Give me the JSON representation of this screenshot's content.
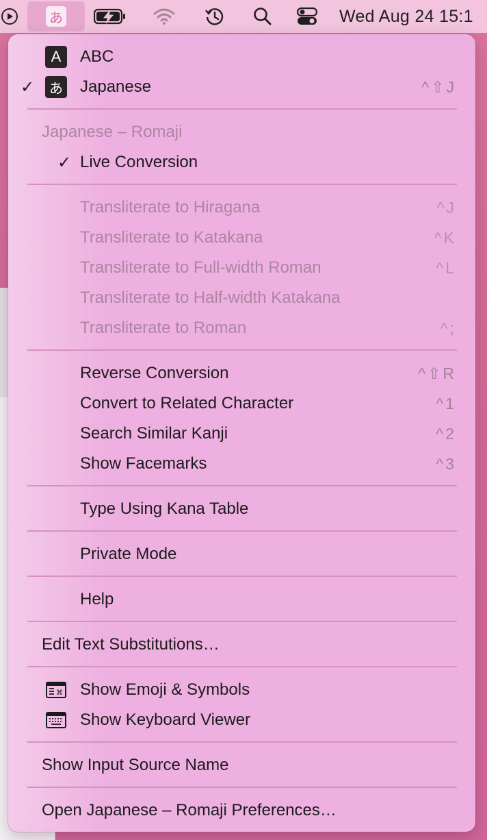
{
  "menubar": {
    "input_icon_glyph": "あ",
    "clock": "Wed Aug 24  15:1",
    "icons": [
      "play-circle-icon",
      "input-source-icon",
      "battery-charging-icon",
      "wifi-icon",
      "time-machine-icon",
      "search-icon",
      "control-center-icon"
    ]
  },
  "menu": {
    "sources": [
      {
        "icon_text": "A",
        "label": "ABC",
        "checked": false,
        "shortcut": ""
      },
      {
        "icon_text": "あ",
        "label": "Japanese",
        "checked": true,
        "shortcut": "^⇧J"
      }
    ],
    "section_header": "Japanese – Romaji",
    "live_conversion": {
      "label": "Live Conversion",
      "checked": true
    },
    "transliterate": [
      {
        "label": "Transliterate to Hiragana",
        "shortcut": "^J"
      },
      {
        "label": "Transliterate to Katakana",
        "shortcut": "^K"
      },
      {
        "label": "Transliterate to Full-width Roman",
        "shortcut": "^L"
      },
      {
        "label": "Transliterate to Half-width Katakana",
        "shortcut": ""
      },
      {
        "label": "Transliterate to Roman",
        "shortcut": "^;"
      }
    ],
    "conversion": [
      {
        "label": "Reverse Conversion",
        "shortcut": "^⇧R"
      },
      {
        "label": "Convert to Related Character",
        "shortcut": "^1"
      },
      {
        "label": "Search Similar Kanji",
        "shortcut": "^2"
      },
      {
        "label": "Show Facemarks",
        "shortcut": "^3"
      }
    ],
    "kana_table": "Type Using Kana Table",
    "private_mode": "Private Mode",
    "help": "Help",
    "edit_substitutions": "Edit Text Substitutions…",
    "show_emoji": "Show Emoji & Symbols",
    "show_keyboard": "Show Keyboard Viewer",
    "show_input_source_name": "Show Input Source Name",
    "open_preferences": "Open Japanese – Romaji Preferences…"
  },
  "colors": {
    "menu_bg": "#eeb0e0",
    "menubar_bg": "#f2c4de",
    "desktop": "#d26a98",
    "disabled_text": "#ad85a3"
  }
}
